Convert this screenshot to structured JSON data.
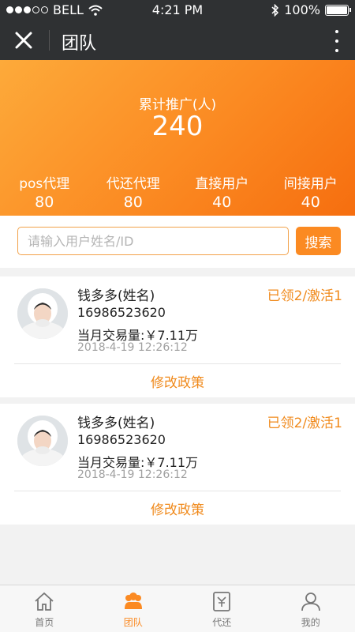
{
  "status_bar": {
    "carrier": "BELL",
    "time": "4:21 PM",
    "battery": "100%"
  },
  "nav": {
    "title": "团队",
    "close_icon": "close-icon",
    "more_icon": "more-vertical-icon"
  },
  "summary": {
    "total_label": "累计推广(人)",
    "total_value": "240",
    "stats": [
      {
        "label": "pos代理",
        "value": "80"
      },
      {
        "label": "代还代理",
        "value": "80"
      },
      {
        "label": "直接用户",
        "value": "40"
      },
      {
        "label": "间接用户",
        "value": "40"
      }
    ]
  },
  "search": {
    "placeholder": "请输入用户姓名/ID",
    "button_label": "搜索"
  },
  "members": [
    {
      "name": "钱多多(姓名)",
      "badge": "已领2/激活1",
      "phone": "16986523620",
      "volume": "当月交易量:￥7.11万",
      "time": "2018-4-19 12:26:12",
      "action": "修改政策"
    },
    {
      "name": "钱多多(姓名)",
      "badge": "已领2/激活1",
      "phone": "16986523620",
      "volume": "当月交易量:￥7.11万",
      "time": "2018-4-19 12:26:12",
      "action": "修改政策"
    }
  ],
  "tabs": [
    {
      "label": "首页",
      "icon": "home-icon",
      "active": false
    },
    {
      "label": "团队",
      "icon": "team-icon",
      "active": true
    },
    {
      "label": "代还",
      "icon": "repay-icon",
      "active": false
    },
    {
      "label": "我的",
      "icon": "profile-icon",
      "active": false
    }
  ],
  "colors": {
    "accent": "#fb8a22",
    "nav_bg": "#2f3133",
    "badge_text": "#f08a1c"
  }
}
